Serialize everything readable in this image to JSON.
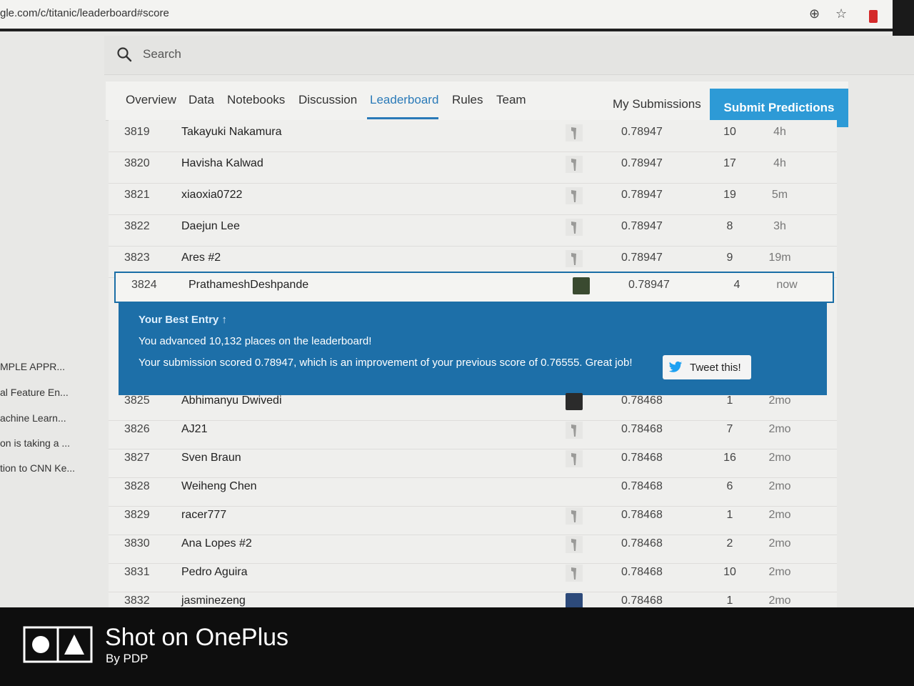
{
  "browser": {
    "url": "gle.com/c/titanic/leaderboard#score"
  },
  "search": {
    "placeholder": "Search"
  },
  "sidebar": {
    "items": [
      "MPLE APPR...",
      "al Feature En...",
      "achine Learn...",
      "on is taking a ...",
      "tion to CNN Ke..."
    ]
  },
  "tabs": [
    {
      "label": "Overview"
    },
    {
      "label": "Data"
    },
    {
      "label": "Notebooks"
    },
    {
      "label": "Discussion"
    },
    {
      "label": "Leaderboard"
    },
    {
      "label": "Rules"
    },
    {
      "label": "Team"
    }
  ],
  "actions": {
    "my_submissions": "My Submissions",
    "submit_predictions": "Submit Predictions"
  },
  "rows_top": [
    {
      "rank": "3819",
      "name": "Takayuki Nakamura",
      "score": "0.78947",
      "entries": "10",
      "last": "4h"
    },
    {
      "rank": "3820",
      "name": "Havisha Kalwad",
      "score": "0.78947",
      "entries": "17",
      "last": "4h"
    },
    {
      "rank": "3821",
      "name": "xiaoxia0722",
      "score": "0.78947",
      "entries": "19",
      "last": "5m"
    },
    {
      "rank": "3822",
      "name": "Daejun Lee",
      "score": "0.78947",
      "entries": "8",
      "last": "3h"
    },
    {
      "rank": "3823",
      "name": "Ares #2",
      "score": "0.78947",
      "entries": "9",
      "last": "19m"
    }
  ],
  "my_row": {
    "rank": "3824",
    "name": "PrathameshDeshpande",
    "score": "0.78947",
    "entries": "4",
    "last": "now"
  },
  "banner": {
    "title": "Your Best Entry ↑",
    "advanced": "You advanced 10,132 places on the leaderboard!",
    "scored": "Your submission scored 0.78947, which is an improvement of your previous score of 0.76555. Great job!",
    "tweet": "Tweet this!"
  },
  "rows_bottom": [
    {
      "rank": "3825",
      "name": "Abhimanyu Dwivedi",
      "score": "0.78468",
      "entries": "1",
      "last": "2mo"
    },
    {
      "rank": "3826",
      "name": "AJ21",
      "score": "0.78468",
      "entries": "7",
      "last": "2mo"
    },
    {
      "rank": "3827",
      "name": "Sven Braun",
      "score": "0.78468",
      "entries": "16",
      "last": "2mo"
    },
    {
      "rank": "3828",
      "name": "Weiheng Chen",
      "score": "0.78468",
      "entries": "6",
      "last": "2mo"
    },
    {
      "rank": "3829",
      "name": "racer777",
      "score": "0.78468",
      "entries": "1",
      "last": "2mo"
    },
    {
      "rank": "3830",
      "name": "Ana Lopes #2",
      "score": "0.78468",
      "entries": "2",
      "last": "2mo"
    },
    {
      "rank": "3831",
      "name": "Pedro Aguira",
      "score": "0.78468",
      "entries": "10",
      "last": "2mo"
    },
    {
      "rank": "3832",
      "name": "jasminezeng",
      "score": "0.78468",
      "entries": "1",
      "last": "2mo"
    }
  ],
  "watermark": {
    "title": "Shot on OnePlus",
    "sub": "By PDP"
  }
}
